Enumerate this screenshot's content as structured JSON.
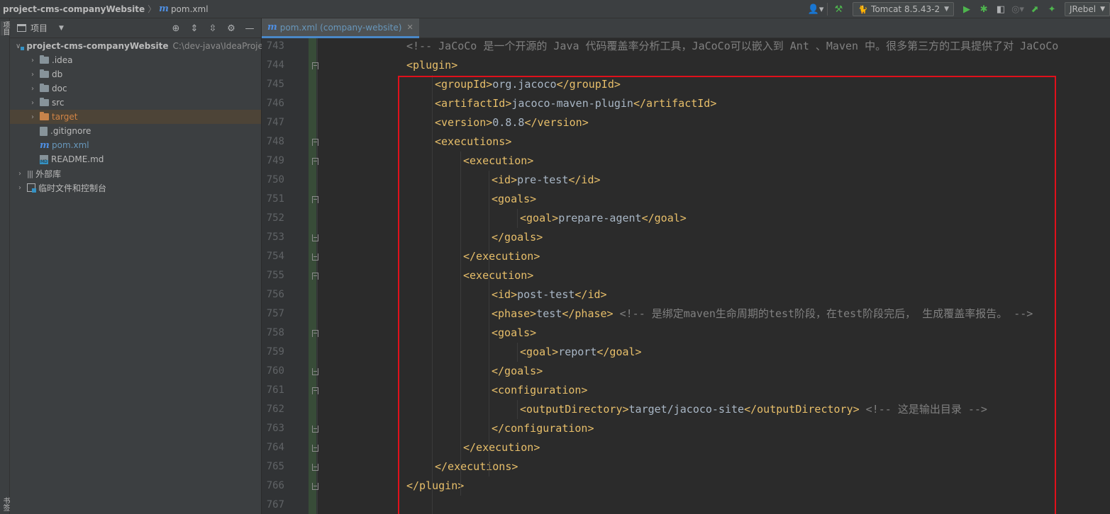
{
  "navbar": {
    "project": "project-cms-companyWebsite",
    "file": "pom.xml",
    "run_config": "Tomcat 8.5.43-2",
    "jrebel": "JRebel"
  },
  "left_strip": {
    "top_label": "项目",
    "bottom_label": "书签"
  },
  "project_panel": {
    "title": "项目",
    "tree": [
      {
        "name": "project-cms-companyWebsite",
        "path": "C:\\dev-java\\IdeaProject",
        "type": "module",
        "expanded": true,
        "indent": 0
      },
      {
        "name": ".idea",
        "type": "folder",
        "indent": 1
      },
      {
        "name": "db",
        "type": "folder",
        "indent": 1
      },
      {
        "name": "doc",
        "type": "folder",
        "indent": 1
      },
      {
        "name": "src",
        "type": "folder",
        "indent": 1
      },
      {
        "name": "target",
        "type": "folder-excluded",
        "indent": 1
      },
      {
        "name": ".gitignore",
        "type": "file",
        "indent": 1
      },
      {
        "name": "pom.xml",
        "type": "maven",
        "indent": 1
      },
      {
        "name": "README.md",
        "type": "md",
        "indent": 1
      },
      {
        "name": "外部库",
        "type": "library",
        "indent": 0
      },
      {
        "name": "临时文件和控制台",
        "type": "scratch",
        "indent": 0
      }
    ]
  },
  "editor": {
    "tab_label": "pom.xml (company-website)",
    "lines": [
      {
        "n": "743",
        "indent": 0,
        "parts": [
          {
            "c": "cmt",
            "t": "<!-- JaCoCo 是一个开源的 Java 代码覆盖率分析工具，JaCoCo可以嵌入到 Ant 、Maven 中。很多第三方的工具提供了对 JaCoCo"
          }
        ]
      },
      {
        "n": "744",
        "indent": 0,
        "fold": "open",
        "parts": [
          {
            "c": "tag",
            "t": "<plugin>"
          }
        ]
      },
      {
        "n": "745",
        "indent": 1,
        "parts": [
          {
            "c": "tag",
            "t": "<groupId>"
          },
          {
            "c": "txt",
            "t": "org.jacoco"
          },
          {
            "c": "tag",
            "t": "</groupId>"
          }
        ]
      },
      {
        "n": "746",
        "indent": 1,
        "parts": [
          {
            "c": "tag",
            "t": "<artifactId>"
          },
          {
            "c": "txt",
            "t": "jacoco-maven-plugin"
          },
          {
            "c": "tag",
            "t": "</artifactId>"
          }
        ]
      },
      {
        "n": "747",
        "indent": 1,
        "parts": [
          {
            "c": "tag",
            "t": "<version>"
          },
          {
            "c": "txt",
            "t": "0.8.8"
          },
          {
            "c": "tag",
            "t": "</version>"
          }
        ]
      },
      {
        "n": "748",
        "indent": 1,
        "fold": "open",
        "parts": [
          {
            "c": "tag",
            "t": "<executions>"
          }
        ]
      },
      {
        "n": "749",
        "indent": 2,
        "fold": "open",
        "parts": [
          {
            "c": "tag",
            "t": "<execution>"
          }
        ]
      },
      {
        "n": "750",
        "indent": 3,
        "parts": [
          {
            "c": "tag",
            "t": "<id>"
          },
          {
            "c": "txt",
            "t": "pre-test"
          },
          {
            "c": "tag",
            "t": "</id>"
          }
        ]
      },
      {
        "n": "751",
        "indent": 3,
        "fold": "open",
        "parts": [
          {
            "c": "tag",
            "t": "<goals>"
          }
        ]
      },
      {
        "n": "752",
        "indent": 4,
        "parts": [
          {
            "c": "tag",
            "t": "<goal>"
          },
          {
            "c": "txt",
            "t": "prepare-agent"
          },
          {
            "c": "tag",
            "t": "</goal>"
          }
        ]
      },
      {
        "n": "753",
        "indent": 3,
        "fold": "close",
        "parts": [
          {
            "c": "tag",
            "t": "</goals>"
          }
        ]
      },
      {
        "n": "754",
        "indent": 2,
        "fold": "close",
        "parts": [
          {
            "c": "tag",
            "t": "</execution>"
          }
        ]
      },
      {
        "n": "755",
        "indent": 2,
        "fold": "open",
        "parts": [
          {
            "c": "tag",
            "t": "<execution>"
          }
        ]
      },
      {
        "n": "756",
        "indent": 3,
        "parts": [
          {
            "c": "tag",
            "t": "<id>"
          },
          {
            "c": "txt",
            "t": "post-test"
          },
          {
            "c": "tag",
            "t": "</id>"
          }
        ]
      },
      {
        "n": "757",
        "indent": 3,
        "parts": [
          {
            "c": "tag",
            "t": "<phase>"
          },
          {
            "c": "txt",
            "t": "test"
          },
          {
            "c": "tag",
            "t": "</phase>"
          },
          {
            "c": "cmt",
            "t": " <!-- 是绑定maven生命周期的test阶段，在test阶段完后， 生成覆盖率报告。 -->"
          }
        ]
      },
      {
        "n": "758",
        "indent": 3,
        "fold": "open",
        "parts": [
          {
            "c": "tag",
            "t": "<goals>"
          }
        ]
      },
      {
        "n": "759",
        "indent": 4,
        "parts": [
          {
            "c": "tag",
            "t": "<goal>"
          },
          {
            "c": "txt",
            "t": "report"
          },
          {
            "c": "tag",
            "t": "</goal>"
          }
        ]
      },
      {
        "n": "760",
        "indent": 3,
        "fold": "close",
        "parts": [
          {
            "c": "tag",
            "t": "</goals>"
          }
        ]
      },
      {
        "n": "761",
        "indent": 3,
        "fold": "open",
        "parts": [
          {
            "c": "tag",
            "t": "<configuration>"
          }
        ]
      },
      {
        "n": "762",
        "indent": 4,
        "parts": [
          {
            "c": "tag",
            "t": "<outputDirectory>"
          },
          {
            "c": "txt",
            "t": "target/jacoco-site"
          },
          {
            "c": "tag",
            "t": "</outputDirectory>"
          },
          {
            "c": "cmt",
            "t": " <!-- 这是输出目录 -->"
          }
        ]
      },
      {
        "n": "763",
        "indent": 3,
        "fold": "close",
        "parts": [
          {
            "c": "tag",
            "t": "</configuration>"
          }
        ]
      },
      {
        "n": "764",
        "indent": 2,
        "fold": "close",
        "parts": [
          {
            "c": "tag",
            "t": "</execution>"
          }
        ]
      },
      {
        "n": "765",
        "indent": 1,
        "fold": "close",
        "parts": [
          {
            "c": "tag",
            "t": "</executions>"
          }
        ]
      },
      {
        "n": "766",
        "indent": 0,
        "fold": "close",
        "parts": [
          {
            "c": "tag",
            "t": "</plugin>"
          }
        ]
      },
      {
        "n": "767",
        "indent": 0,
        "parts": []
      }
    ]
  },
  "colors": {
    "highlight_box": "#e0101b",
    "xml_tag": "#e8bf6a",
    "comment": "#808080",
    "text": "#a9b7c6"
  }
}
